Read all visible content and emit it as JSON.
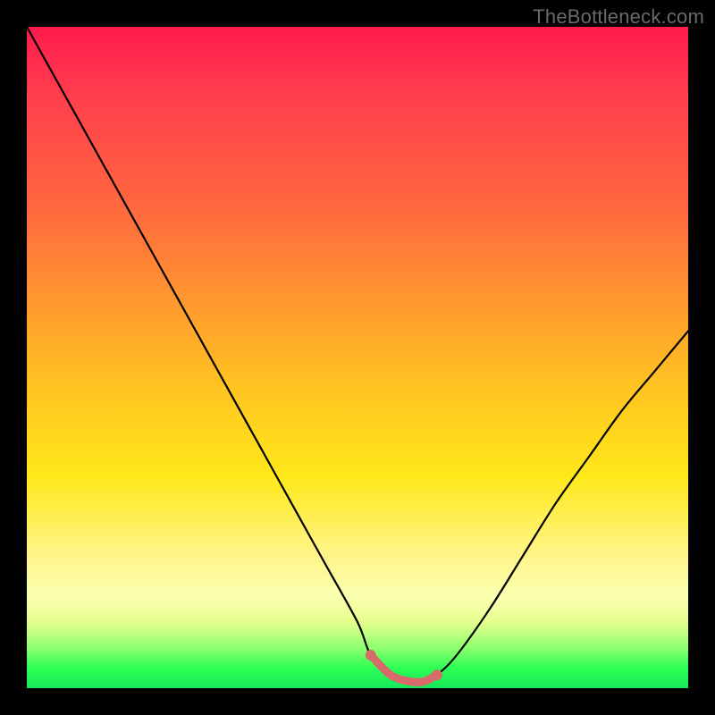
{
  "watermark": "TheBottleneck.com",
  "colors": {
    "frame": "#000000",
    "curve": "#000000",
    "highlight": "#d86a6a",
    "gradient_top": "#ff1a4d",
    "gradient_bottom": "#15e85a"
  },
  "chart_data": {
    "type": "line",
    "title": "",
    "xlabel": "",
    "ylabel": "",
    "xlim": [
      0,
      100
    ],
    "ylim": [
      0,
      100
    ],
    "grid": false,
    "legend": false,
    "annotations": [],
    "series": [
      {
        "name": "bottleneck-curve",
        "x": [
          0,
          5,
          10,
          15,
          20,
          25,
          30,
          35,
          40,
          45,
          50,
          52,
          55,
          58,
          60,
          62,
          65,
          70,
          75,
          80,
          85,
          90,
          95,
          100
        ],
        "values": [
          100,
          91,
          82,
          73,
          64,
          55,
          46,
          37,
          28,
          19,
          10,
          5,
          2,
          1,
          1,
          2,
          5,
          12,
          20,
          28,
          35,
          42,
          48,
          54
        ]
      },
      {
        "name": "optimal-flat-segment",
        "x": [
          52,
          55,
          58,
          60,
          62
        ],
        "values": [
          5,
          2,
          1,
          1,
          2
        ]
      }
    ],
    "endpoints": [
      {
        "x": 52,
        "y": 5
      },
      {
        "x": 62,
        "y": 2
      }
    ]
  }
}
